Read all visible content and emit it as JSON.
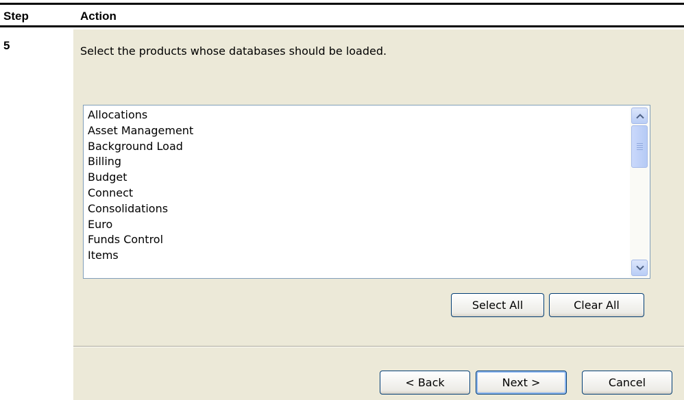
{
  "table": {
    "header_step": "Step",
    "header_action": "Action",
    "step_number": "5"
  },
  "dialog": {
    "instruction": "Select the products whose databases should be loaded.",
    "products": [
      "Allocations",
      "Asset Management",
      "Background Load",
      "Billing",
      "Budget",
      "Connect",
      "Consolidations",
      "Euro",
      "Funds Control",
      "Items"
    ],
    "buttons": {
      "select_all": "Select All",
      "clear_all": "Clear All",
      "back": "< Back",
      "next": "Next >",
      "cancel": "Cancel"
    }
  },
  "colors": {
    "dialog_background": "#ECE9D8",
    "listbox_border": "#7F9DB9",
    "button_border": "#003C74"
  }
}
